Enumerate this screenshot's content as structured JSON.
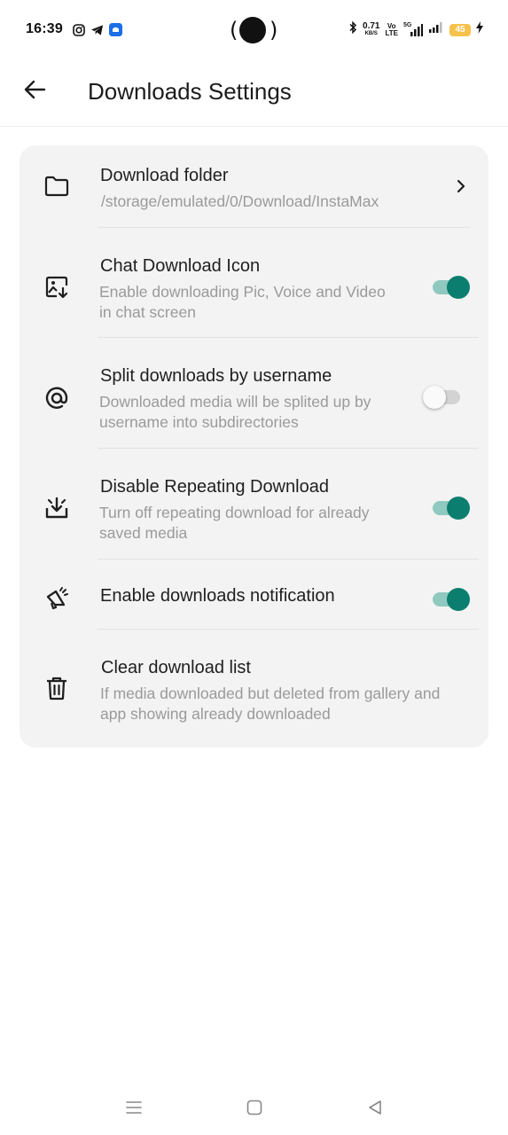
{
  "status_bar": {
    "time": "16:39",
    "apps": [
      "instagram-icon",
      "telegram-icon",
      "app-icon"
    ],
    "net_speed_value": "0.71",
    "net_speed_unit": "KB/S",
    "volte_line1": "Vo",
    "volte_line2": "LTE",
    "network_type": "5G",
    "battery": "45",
    "battery_color": "#f5c24b"
  },
  "app_bar": {
    "title": "Downloads Settings",
    "back_icon": "arrow-left-icon"
  },
  "settings": {
    "download_folder": {
      "title": "Download folder",
      "subtitle": "/storage/emulated/0/Download/InstaMax",
      "icon": "folder-icon"
    },
    "chat_download_icon": {
      "title": "Chat Download Icon",
      "subtitle_line1": "Enable downloading Pic, Voice and Video",
      "subtitle_line2": "in chat screen",
      "enabled": true,
      "icon": "image-download-icon"
    },
    "split_by_username": {
      "title": "Split downloads by username",
      "subtitle_line1": "Downloaded media will be splited up by",
      "subtitle_line2": "username into subdirectories",
      "enabled": false,
      "icon": "at-sign-icon"
    },
    "disable_repeating": {
      "title": "Disable Repeating Download",
      "subtitle_line1": "Turn off repeating download for already",
      "subtitle_line2": "saved media",
      "enabled": true,
      "icon": "download-tray-icon"
    },
    "downloads_notification": {
      "title": "Enable downloads notification",
      "enabled": true,
      "icon": "megaphone-icon"
    },
    "clear_list": {
      "title": "Clear download list",
      "subtitle_line1": "If media downloaded but deleted from gallery and",
      "subtitle_line2": "app showing already downloaded",
      "icon": "trash-icon"
    }
  },
  "colors": {
    "accent": "#0b7e6f",
    "accent_track": "#8fc9c0",
    "card_bg": "#f3f3f3",
    "subtitle": "#9a9a9a"
  },
  "nav_bar": [
    "menu-icon",
    "home-square-icon",
    "back-triangle-icon"
  ]
}
